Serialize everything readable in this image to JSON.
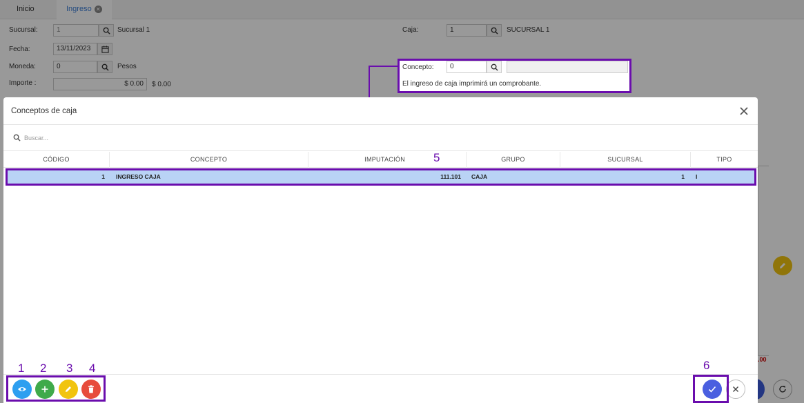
{
  "tabs": [
    {
      "label": "Inicio"
    },
    {
      "label": "Ingreso"
    }
  ],
  "form": {
    "sucursal": {
      "label": "Sucursal:",
      "value": "1",
      "name": "Sucursal 1"
    },
    "fecha": {
      "label": "Fecha:",
      "value": "13/11/2023"
    },
    "moneda": {
      "label": "Moneda:",
      "value": "0",
      "name": "Pesos"
    },
    "importe": {
      "label": "Importe :",
      "value": "$ 0.00",
      "text": "$ 0.00"
    },
    "caja": {
      "label": "Caja:",
      "value": "1",
      "name": "SUCURSAL 1"
    },
    "concepto": {
      "label": "Concepto:",
      "value": "0",
      "description": "",
      "note": "El ingreso de caja imprimirá un comprobante."
    }
  },
  "background": {
    "red_amount": ".00"
  },
  "modal": {
    "title": "Conceptos de caja",
    "search_placeholder": "Buscar...",
    "columns": [
      "CÓDIGO",
      "CONCEPTO",
      "IMPUTACIÓN",
      "GRUPO",
      "SUCURSAL",
      "TIPO"
    ],
    "rows": [
      {
        "codigo": "1",
        "concepto": "INGRESO CAJA",
        "imputacion": "111.101",
        "grupo": "CAJA",
        "sucursal": "1",
        "tipo": "I"
      }
    ]
  },
  "annotations": [
    "1",
    "2",
    "3",
    "4",
    "5",
    "6"
  ],
  "colors": {
    "annotation": "#6a0dad",
    "view": "#2d9ff0",
    "add": "#3faa4a",
    "edit": "#f1c40f",
    "delete": "#e74c3c",
    "confirm": "#4a5fe0",
    "selected_row": "#b9d3f5"
  },
  "icons": {
    "view": "eye-icon",
    "add": "plus-icon",
    "edit": "pencil-icon",
    "delete": "trash-icon",
    "confirm": "check-icon",
    "cancel": "close-icon"
  }
}
